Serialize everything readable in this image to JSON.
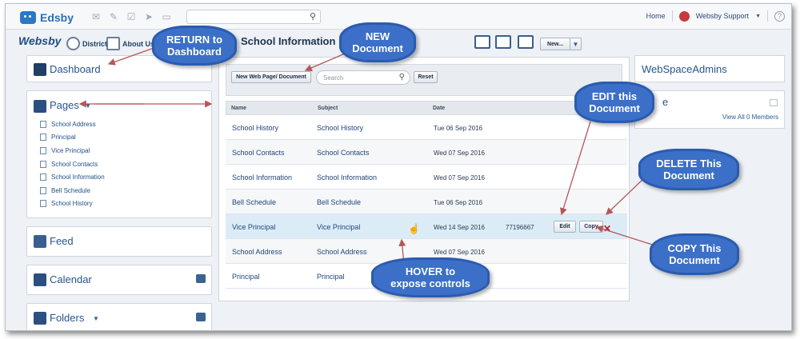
{
  "topbar": {
    "logo": "Edsby",
    "home": "Home",
    "user": "Websby Support",
    "help": "?"
  },
  "navbar": {
    "brand": "Websby",
    "district": "District",
    "about": "About Us",
    "page_title": "School Information",
    "new_button": "New...",
    "new_dropdown": "▼"
  },
  "left": {
    "dashboard": "Dashboard",
    "pages": "Pages",
    "pages_toggle": "▼",
    "page_items": [
      "School Address",
      "Principal",
      "Vice Principal",
      "School Contacts",
      "School Information",
      "Bell Schedule",
      "School History"
    ],
    "feed": "Feed",
    "calendar": "Calendar",
    "folders": "Folders",
    "folders_toggle": "▼"
  },
  "toolbar": {
    "new_page_doc": "New Web Page/ Document",
    "search_placeholder": "Search",
    "reset": "Reset"
  },
  "table": {
    "headers": [
      "Name",
      "Subject",
      "Date"
    ],
    "rows": [
      {
        "name": "School History",
        "subject": "School History",
        "date": "Tue 06 Sep 2016",
        "extra": ""
      },
      {
        "name": "School Contacts",
        "subject": "School Contacts",
        "date": "Wed 07 Sep 2016",
        "extra": ""
      },
      {
        "name": "School Information",
        "subject": "School Information",
        "date": "Wed 07 Sep 2016",
        "extra": ""
      },
      {
        "name": "Bell Schedule",
        "subject": "Bell Schedule",
        "date": "Tue 06 Sep 2016",
        "extra": ""
      },
      {
        "name": "Vice Principal",
        "subject": "Vice Principal",
        "date": "Wed 14 Sep 2016",
        "extra": "77196667"
      },
      {
        "name": "School Address",
        "subject": "School Address",
        "date": "Wed 07 Sep 2016",
        "extra": ""
      },
      {
        "name": "Principal",
        "subject": "Principal",
        "date": "",
        "extra": ""
      }
    ],
    "edit": "Edit",
    "copy": "Copy",
    "delete": "✕"
  },
  "right": {
    "admins": "WebSpaceAdmins",
    "members_partial": "e",
    "view_all": "View All 0 Members"
  },
  "callouts": {
    "return": "RETURN to\nDashboard",
    "new_doc": "NEW\nDocument",
    "edit": "EDIT this\nDocument",
    "delete": "DELETE This\nDocument",
    "copy": "COPY This\nDocument",
    "hover": "HOVER to\nexpose controls"
  },
  "colors": {
    "callout": "#3c6fc7",
    "arrow": "#b5575a",
    "link": "#26558e",
    "highlight_row": "#dcecf7"
  }
}
